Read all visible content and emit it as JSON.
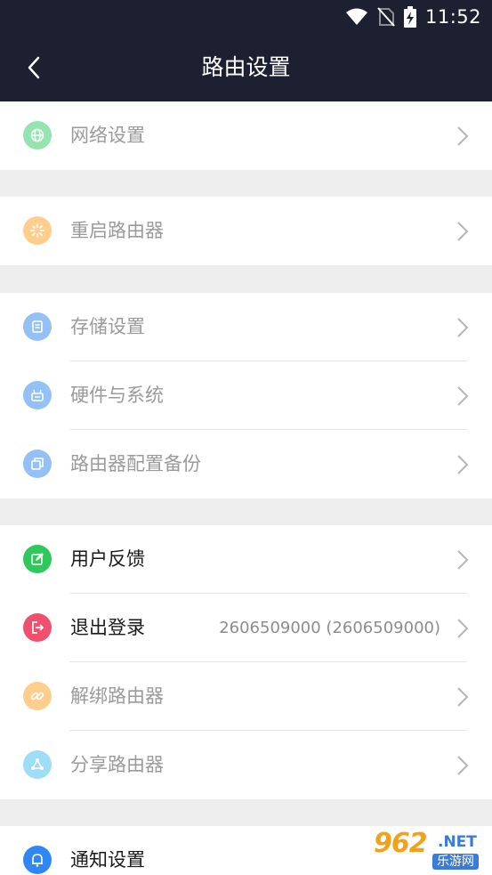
{
  "status_bar": {
    "time": "11:52"
  },
  "header": {
    "title": "路由设置"
  },
  "groups": [
    {
      "items": [
        {
          "label": "网络设置",
          "icon": "globe-icon",
          "color": "#3ecf6e",
          "enabled": false
        }
      ]
    },
    {
      "items": [
        {
          "label": "重启路由器",
          "icon": "restart-icon",
          "color": "#ffa52f",
          "enabled": false
        }
      ]
    },
    {
      "items": [
        {
          "label": "存储设置",
          "icon": "storage-icon",
          "color": "#3b8ff0",
          "enabled": false
        },
        {
          "label": "硬件与系统",
          "icon": "hardware-icon",
          "color": "#3b8ff0",
          "enabled": false
        },
        {
          "label": "路由器配置备份",
          "icon": "backup-icon",
          "color": "#3b8ff0",
          "enabled": false
        }
      ]
    },
    {
      "items": [
        {
          "label": "用户反馈",
          "icon": "feedback-icon",
          "color": "#2ec95a",
          "enabled": true
        },
        {
          "label": "退出登录",
          "icon": "logout-icon",
          "color": "#f0506e",
          "enabled": true,
          "value": "2606509000 (2606509000)"
        },
        {
          "label": "解绑路由器",
          "icon": "unbind-icon",
          "color": "#ffa52f",
          "enabled": false
        },
        {
          "label": "分享路由器",
          "icon": "share-icon",
          "color": "#4ec3f0",
          "enabled": false
        }
      ]
    },
    {
      "items": [
        {
          "label": "通知设置",
          "icon": "bell-icon",
          "color": "#2f86f5",
          "enabled": true
        }
      ]
    }
  ],
  "watermark": {
    "big": "962",
    "net": ".NET",
    "small": "乐游网"
  }
}
